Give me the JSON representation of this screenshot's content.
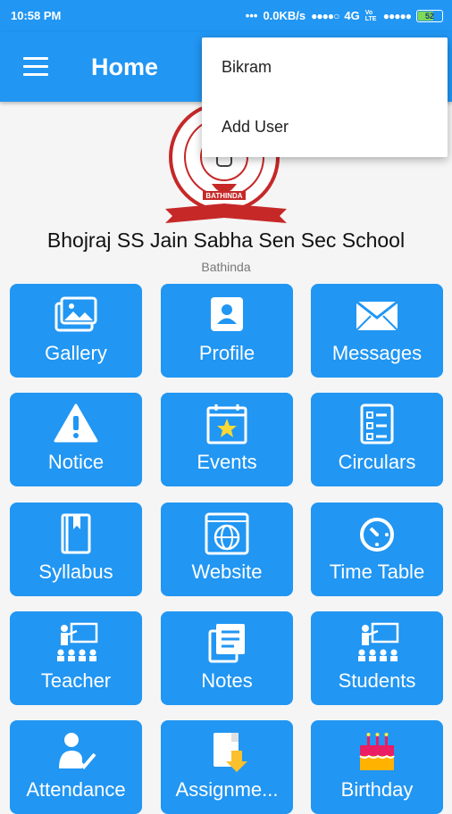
{
  "status_bar": {
    "time": "10:58 PM",
    "dots": "•••",
    "speed": "0.0KB/s",
    "signal1": "●●●●○",
    "network": "4G",
    "volte": "Vo LTE",
    "signal2": "●●●●●",
    "battery": "52"
  },
  "app_bar": {
    "title": "Home",
    "menu_icon": "hamburger-menu-icon"
  },
  "overflow_menu": {
    "items": [
      "Bikram",
      "Add User"
    ]
  },
  "school": {
    "logo_text": "BATHINDA",
    "name": "Bhojraj SS Jain Sabha Sen Sec School",
    "city": "Bathinda"
  },
  "tiles": [
    {
      "label": "Gallery",
      "icon": "gallery-icon"
    },
    {
      "label": "Profile",
      "icon": "profile-icon"
    },
    {
      "label": "Messages",
      "icon": "envelope-icon"
    },
    {
      "label": "Notice",
      "icon": "warning-icon"
    },
    {
      "label": "Events",
      "icon": "calendar-star-icon"
    },
    {
      "label": "Circulars",
      "icon": "checklist-icon"
    },
    {
      "label": "Syllabus",
      "icon": "book-icon"
    },
    {
      "label": "Website",
      "icon": "globe-icon"
    },
    {
      "label": "Time Table",
      "icon": "timer-icon"
    },
    {
      "label": "Teacher",
      "icon": "teacher-icon"
    },
    {
      "label": "Notes",
      "icon": "notes-icon"
    },
    {
      "label": "Students",
      "icon": "students-icon"
    },
    {
      "label": "Attendance",
      "icon": "attendance-icon"
    },
    {
      "label": "Assignme...",
      "icon": "assignment-icon"
    },
    {
      "label": "Birthday",
      "icon": "birthday-cake-icon"
    }
  ],
  "colors": {
    "primary": "#2196f3",
    "menu_bg": "#ffffff",
    "page_bg": "#f5f5f5"
  }
}
